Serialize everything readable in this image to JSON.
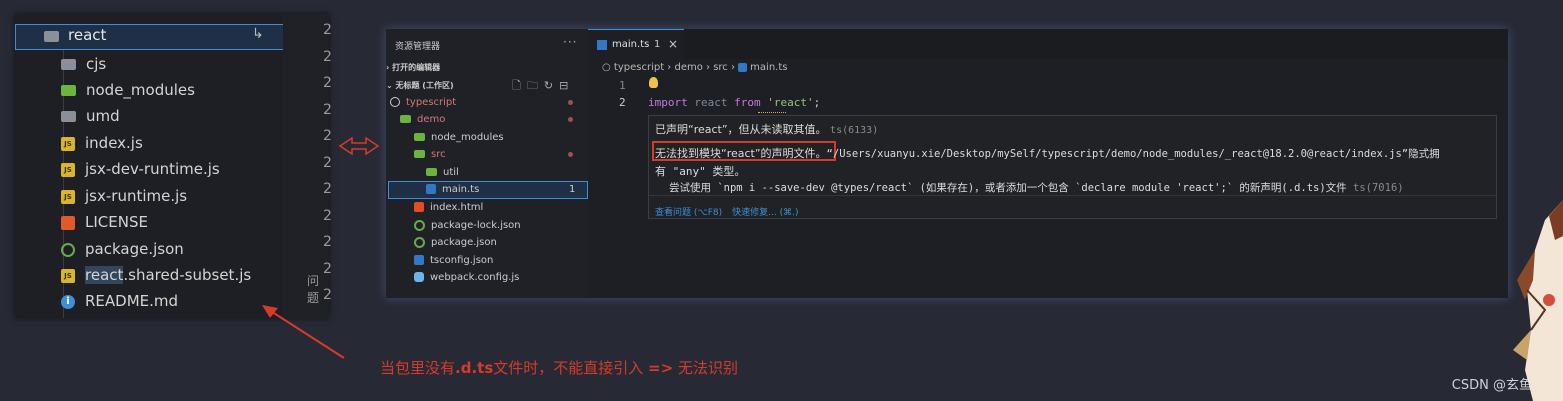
{
  "left_explorer": {
    "root_folder": "react",
    "root_arrow": "↳",
    "items": [
      {
        "label": "cjs",
        "icon": "folder-icon"
      },
      {
        "label": "node_modules",
        "icon": "folder-green-icon"
      },
      {
        "label": "umd",
        "icon": "folder-icon"
      },
      {
        "label": "index.js",
        "icon": "js-file-icon"
      },
      {
        "label": "jsx-dev-runtime.js",
        "icon": "js-file-icon"
      },
      {
        "label": "jsx-runtime.js",
        "icon": "js-file-icon"
      },
      {
        "label": "LICENSE",
        "icon": "license-icon"
      },
      {
        "label": "package.json",
        "icon": "json-file-icon"
      },
      {
        "label": "react.shared-subset.js",
        "icon": "js-file-icon",
        "highlight": "react"
      },
      {
        "label": "README.md",
        "icon": "info-icon"
      }
    ],
    "gutter_numbers": [
      "2",
      "2",
      "2",
      "2",
      "2",
      "2",
      "2",
      "2",
      "2",
      "2",
      "2"
    ],
    "problems_label": "问题"
  },
  "annotation": {
    "prefix": "当包里没有",
    "bold1": ".d.ts",
    "middle": "文件时，不能直接引入 ",
    "bold2": "=>",
    "suffix": " 无法识别"
  },
  "credit": "CSDN @玄鱼殇",
  "vscode": {
    "sidebar": {
      "title": "资源管理器",
      "more": "···",
      "open_editors": "打开的编辑器",
      "workspace": "无标题 (工作区)",
      "tree": [
        {
          "label": "typescript",
          "kind": "root",
          "badge": ""
        },
        {
          "label": "demo",
          "kind": "folder-open",
          "badge": ""
        },
        {
          "label": "node_modules",
          "kind": "folder",
          "badge": ""
        },
        {
          "label": "src",
          "kind": "folder-open",
          "badge": ""
        },
        {
          "label": "util",
          "kind": "folder",
          "badge": ""
        },
        {
          "label": "main.ts",
          "kind": "ts",
          "badge": "1"
        },
        {
          "label": "index.html",
          "kind": "html",
          "badge": ""
        },
        {
          "label": "package-lock.json",
          "kind": "json",
          "badge": ""
        },
        {
          "label": "package.json",
          "kind": "json",
          "badge": ""
        },
        {
          "label": "tsconfig.json",
          "kind": "ts",
          "badge": ""
        },
        {
          "label": "webpack.config.js",
          "kind": "webpack",
          "badge": ""
        }
      ]
    },
    "tab": {
      "label": "main.ts",
      "count": "1",
      "close": "×"
    },
    "breadcrumb": [
      "typescript",
      "demo",
      "src",
      "main.ts"
    ],
    "line_numbers": [
      "1",
      "2"
    ],
    "code": {
      "kw1": "import",
      "id": "react",
      "kw2": "from",
      "str": "'react'",
      "end": ";"
    },
    "hover": {
      "line1": "已声明“react”，但从未读取其值。",
      "line1_code": "ts(6133)",
      "boxed": "无法找到模块“react”的声明文件。",
      "line2_rest": "“/Users/xuanyu.xie/Desktop/mySelf/typescript/demo/node_modules/_react@18.2.0@react/index.js”隐式拥",
      "line3": "有 \"any\" 类型。",
      "line4": "尝试使用 `npm i --save-dev @types/react` (如果存在)，或者添加一个包含 `declare module 'react';` 的新声明(.d.ts)文件",
      "line4_code": "ts(7016)",
      "action1": "查看问题 (⌥F8)",
      "action2": "快速修复... (⌘.)"
    }
  }
}
